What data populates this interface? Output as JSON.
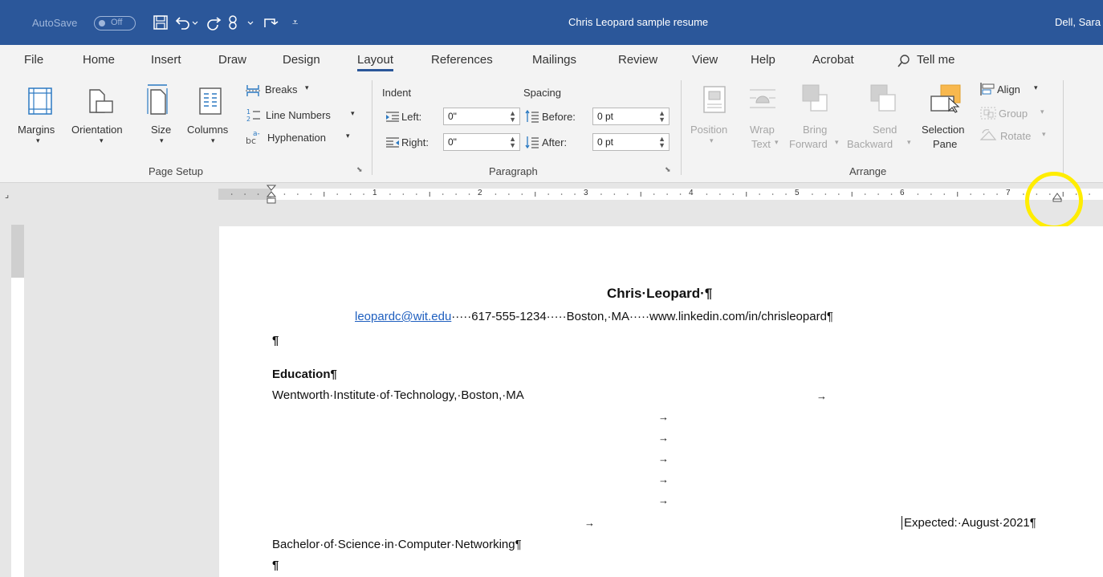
{
  "titlebar": {
    "autosave_label": "AutoSave",
    "autosave_state": "Off",
    "doc_title": "Chris Leopard sample resume",
    "user": "Dell, Sara"
  },
  "tabs": [
    "File",
    "Home",
    "Insert",
    "Draw",
    "Design",
    "Layout",
    "References",
    "Mailings",
    "Review",
    "View",
    "Help",
    "Acrobat",
    "Tell me"
  ],
  "active_tab": "Layout",
  "ribbon": {
    "page_setup": {
      "margins": "Margins",
      "orientation": "Orientation",
      "size": "Size",
      "columns": "Columns",
      "breaks": "Breaks",
      "line_numbers": "Line Numbers",
      "hyphenation": "Hyphenation",
      "group_label": "Page Setup"
    },
    "paragraph": {
      "indent_label": "Indent",
      "spacing_label": "Spacing",
      "left_label": "Left:",
      "right_label": "Right:",
      "before_label": "Before:",
      "after_label": "After:",
      "left_value": "0\"",
      "right_value": "0\"",
      "before_value": "0 pt",
      "after_value": "0 pt",
      "group_label": "Paragraph"
    },
    "arrange": {
      "position": "Position",
      "wrap_text": [
        "Wrap",
        "Text"
      ],
      "bring_forward": [
        "Bring",
        "Forward"
      ],
      "send_backward": [
        "Send",
        "Backward"
      ],
      "selection_pane": [
        "Selection",
        "Pane"
      ],
      "align": "Align",
      "group": "Group",
      "rotate": "Rotate",
      "group_label": "Arrange"
    }
  },
  "ruler_numbers": [
    "1",
    "2",
    "3",
    "4",
    "5",
    "6",
    "7"
  ],
  "document": {
    "name": "Chris·Leopard·¶",
    "email": "leopardc@wit.edu",
    "contact_rest": "·····617-555-1234·····Boston,·MA·····www.linkedin.com/in/chrisleopard¶",
    "pilcrow": "¶",
    "education_heading": "Education¶",
    "school": "Wentworth·Institute·of·Technology,·Boston,·MA",
    "tab_arrow": "→",
    "expected": "Expected:·August·2021¶",
    "degree": "Bachelor·of·Science·in·Computer·Networking¶"
  }
}
